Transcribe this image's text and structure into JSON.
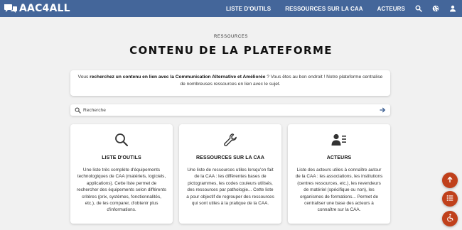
{
  "brand": {
    "name": "AAC4ALL",
    "logo_icon": "speech-bubbles-icon"
  },
  "nav": {
    "links": [
      "LISTE D'OUTILS",
      "RESSOURCES SUR LA CAA",
      "ACTEURS"
    ],
    "icons": [
      "search-icon",
      "globe-icon",
      "user-icon"
    ]
  },
  "header": {
    "eyebrow": "RESSOURCES",
    "title": "CONTENU DE LA PLATEFORME"
  },
  "intro": {
    "part1": "Vous ",
    "bold1": "recherchez un contenu en lien avec la Communication Alternative et Améliorée",
    "part2": " ? Vous êtes au bon endroit ! Notre plateforme centralise de nombreuses ressources en lien avec le sujet."
  },
  "search": {
    "placeholder": "Recherche",
    "icon": "search-icon",
    "submit_icon": "arrow-right-icon"
  },
  "cards": [
    {
      "icon": "magnifier-icon",
      "title": "LISTE D'OUTILS",
      "description": "Une liste très complète d'équipements technologiques de CAA (matériels, logiciels, applications). Cette liste permet de rechercher des équipements selon différents critères (prix, systèmes, fonctionnalités, etc.), de les comparer, d'obtenir plus d'informations."
    },
    {
      "icon": "wrench-icon",
      "title": "RESSOURCES SUR LA CAA",
      "description": "Une liste de ressources utiles lorsqu'on fait de la CAA : les différentes bases de pictogrammes, les codes couleurs utilisés, des ressources par pathologie... Cette liste a pour objectif de regrouper des ressources qui sont utiles à la pratique de la CAA."
    },
    {
      "icon": "user-list-icon",
      "title": "ACTEURS",
      "description": "Liste des acteurs utiles à connaître autour de la CAA : les associations, les institutions (centres ressources, etc.), les revendeurs de matériel (spécifique ou non), les organismes de formations... Permet de centraliser une base des acteurs à connaître sur la CAA."
    }
  ],
  "fabs": [
    "arrow-up-icon",
    "list-icon",
    "accessibility-icon"
  ],
  "colors": {
    "navbar": "#44669a",
    "fab": "#c0401b",
    "background": "#f1f1f1",
    "link_accent": "#3a5d91"
  }
}
